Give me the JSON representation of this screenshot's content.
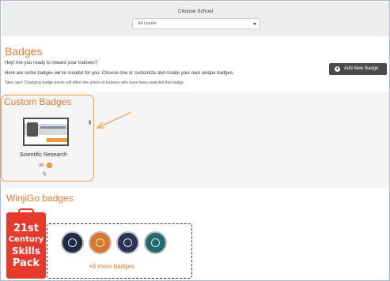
{
  "school_filter": {
    "label": "Choose School",
    "selected": "All Levels"
  },
  "badges": {
    "title": "Badges",
    "intro_line1": "Hey! Are you ready to reward your trainees?",
    "intro_line2": "Here are some badges we've created for you. Choose one or customize and create your own unique badges.",
    "note": "Take care! Changing badge points will affect the points of trainees who have been awarded this badge.",
    "add_button": "Add New Badge"
  },
  "custom_badges": {
    "title": "Custom Badges",
    "items": [
      {
        "name": "Scientific Research",
        "points": "20"
      }
    ]
  },
  "winjigo_badges": {
    "title": "WinjiGo badges",
    "pack": {
      "line1": "21st",
      "line2": "Century",
      "line3": "Skills",
      "line4": "Pack"
    },
    "more_label": "+8 more badges"
  },
  "colors": {
    "accent": "#e07b2f",
    "highlight_border": "#f0a044",
    "button": "#4a4a4a",
    "pack": "#e63a2c"
  }
}
